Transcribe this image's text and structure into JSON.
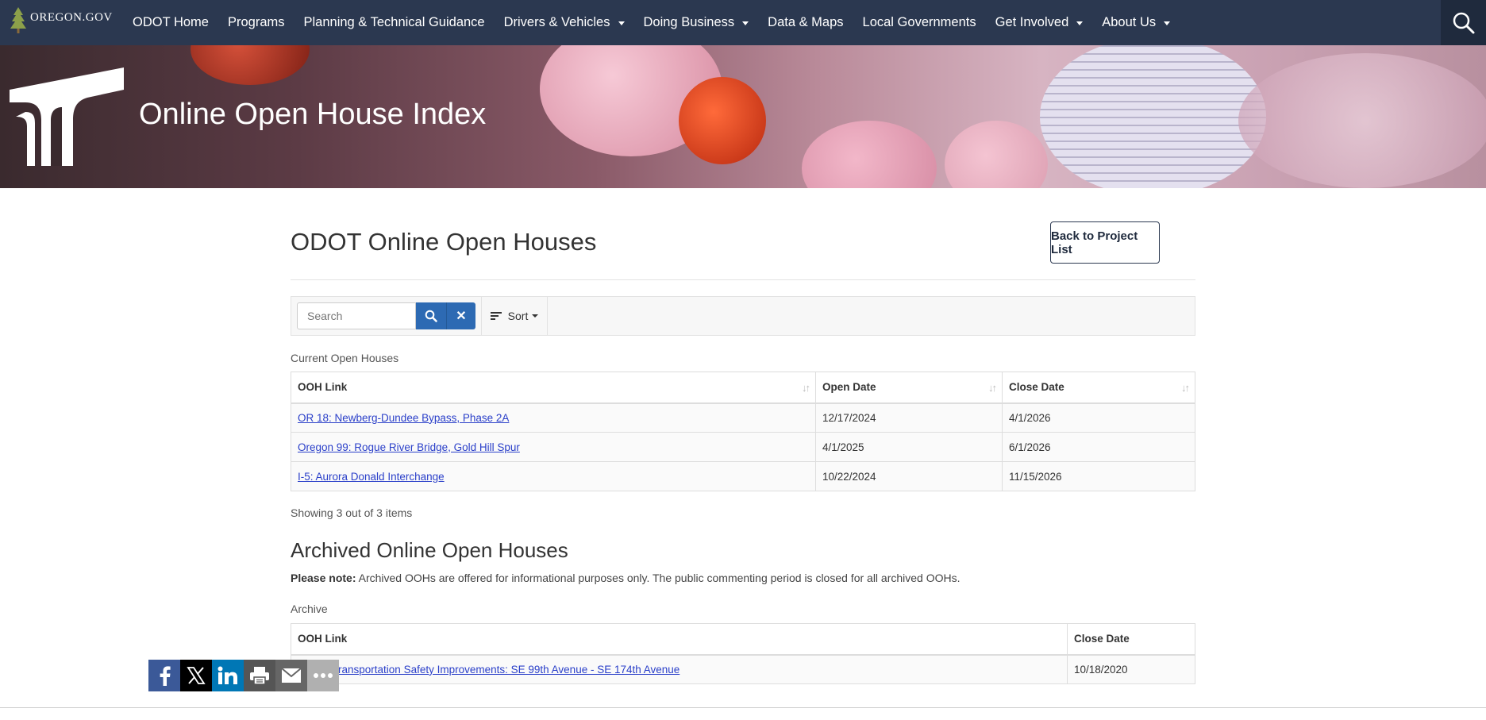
{
  "header": {
    "logo_text": "OREGON.GOV",
    "nav": [
      {
        "label": "ODOT Home",
        "dropdown": false
      },
      {
        "label": "Programs",
        "dropdown": false
      },
      {
        "label": "Planning & Technical Guidance",
        "dropdown": false
      },
      {
        "label": "Drivers & Vehicles",
        "dropdown": true
      },
      {
        "label": "Doing Business",
        "dropdown": true
      },
      {
        "label": "Data & Maps",
        "dropdown": false
      },
      {
        "label": "Local Governments",
        "dropdown": false
      },
      {
        "label": "Get Involved",
        "dropdown": true
      },
      {
        "label": "About Us",
        "dropdown": true
      }
    ],
    "colors": {
      "nav_bg": "#2b3850"
    }
  },
  "banner": {
    "title": "Online Open House Index"
  },
  "main": {
    "page_title": "ODOT Online Open Houses",
    "back_button": "Back to Project List",
    "toolbar": {
      "search_placeholder": "Search",
      "sort_label": "Sort"
    },
    "current": {
      "caption": "Current Open Houses",
      "columns": [
        "OOH Link",
        "Open Date",
        "Close Date"
      ],
      "rows": [
        {
          "link": "OR 18: Newberg-Dundee Bypass, Phase 2A",
          "open": "12/17/2024",
          "close": "4/1/2026"
        },
        {
          "link": "Oregon 99: Rogue River Bridge, Gold Hill Spur",
          "open": "4/1/2025",
          "close": "6/1/2026"
        },
        {
          "link": "I-5: Aurora Donald Interchange",
          "open": "10/22/2024",
          "close": "11/15/2026"
        }
      ],
      "showing": "Showing 3 out of 3 items"
    },
    "archive": {
      "title": "Archived Online Open Houses",
      "note_label": "Please note:",
      "note_text": " Archived OOHs are offered for informational purposes only. The public commenting period is closed for all archived OOHs.",
      "caption": "Archive",
      "columns": [
        "OOH Link",
        "Close Date"
      ],
      "rows": [
        {
          "link": "Powell Transportation Safety Improvements: SE 99th Avenue - SE 174th Avenue",
          "close": "10/18/2020"
        }
      ]
    }
  },
  "share": {
    "icons": [
      "facebook-icon",
      "x-icon",
      "linkedin-icon",
      "print-icon",
      "email-icon",
      "more-icon"
    ],
    "colors": {
      "facebook": "#3b5998",
      "x": "#000000",
      "linkedin": "#0077b5",
      "print": "#555555",
      "email": "#666666",
      "more": "#b0b0b0"
    }
  }
}
